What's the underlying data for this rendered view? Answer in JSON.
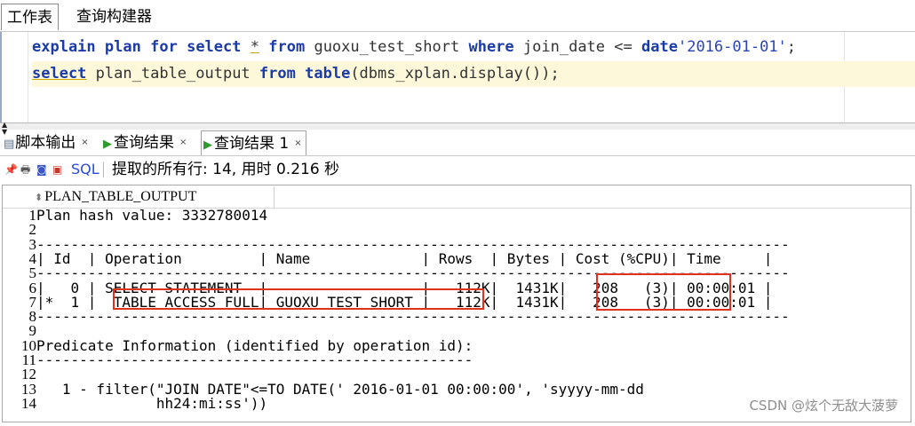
{
  "tabs": {
    "worksheet": "工作表",
    "query_builder": "查询构建器"
  },
  "editor": {
    "line1": {
      "explain": "explain",
      "plan": "plan",
      "for": "for",
      "select": "select",
      "star": "*",
      "from": "from",
      "table": "guoxu_test_short",
      "where": "where",
      "col": "join_date",
      "op": "<=",
      "date_kw": "date",
      "date_lit": "'2016-01-01'",
      "semi": ";"
    },
    "line2": {
      "select": "select",
      "col": "plan_table_output",
      "from": "from",
      "table_kw": "table",
      "call": "(dbms_xplan.display());"
    }
  },
  "result_tabs": [
    {
      "label": "脚本输出",
      "icon": "script-output-icon"
    },
    {
      "label": "查询结果",
      "icon": "run-icon"
    },
    {
      "label": "查询结果 1",
      "icon": "run-icon"
    }
  ],
  "toolbar": {
    "sql_label": "SQL",
    "status": "提取的所有行: 14, 用时 0.216 秒"
  },
  "grid": {
    "column": "PLAN_TABLE_OUTPUT",
    "rows": [
      {
        "n": "1",
        "text": "Plan hash value: 3332780014"
      },
      {
        "n": "2",
        "text": ""
      },
      {
        "n": "3",
        "text": "----------------------------------------------------------------------------------------"
      },
      {
        "n": "4",
        "text": "| Id  | Operation         | Name             | Rows  | Bytes | Cost (%CPU)| Time     |"
      },
      {
        "n": "5",
        "text": "----------------------------------------------------------------------------------------"
      },
      {
        "n": "6",
        "text": "|   0 | SELECT STATEMENT  |                  |   112K|  1431K|   208   (3)| 00:00:01 |"
      },
      {
        "n": "7",
        "text": "|*  1 |  TABLE ACCESS FULL| GUOXU_TEST_SHORT |   112K|  1431K|   208   (3)| 00:00:01 |"
      },
      {
        "n": "8",
        "text": "----------------------------------------------------------------------------------------"
      },
      {
        "n": "9",
        "text": ""
      },
      {
        "n": "10",
        "text": "Predicate Information (identified by operation id):"
      },
      {
        "n": "11",
        "text": "---------------------------------------------------"
      },
      {
        "n": "12",
        "text": ""
      },
      {
        "n": "13",
        "text": "   1 - filter(\"JOIN_DATE\"<=TO_DATE(' 2016-01-01 00:00:00', 'syyyy-mm-dd"
      },
      {
        "n": "14",
        "text": "              hh24:mi:ss'))"
      }
    ]
  },
  "watermark": "CSDN @炫个无敌大菠萝",
  "colors": {
    "keyword": "#1a3ba8",
    "highlight_box": "#e0311f",
    "current_line": "#fdf8da"
  }
}
